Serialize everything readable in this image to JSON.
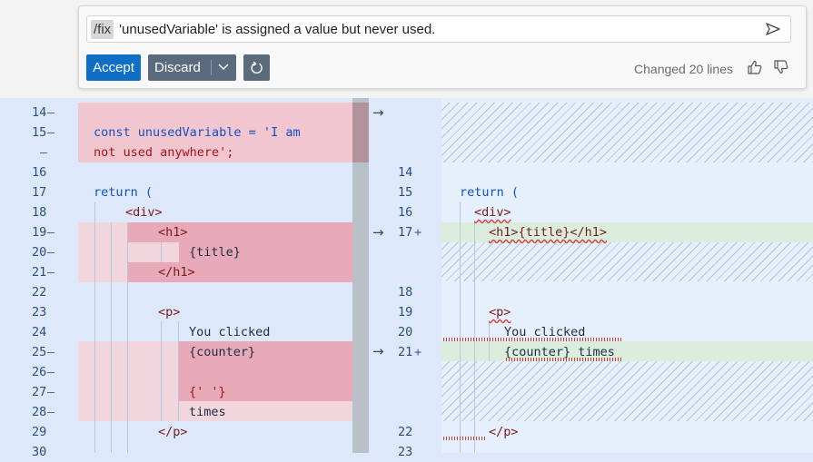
{
  "prompt": {
    "slash_command": "/fix",
    "text": "'unusedVariable' is assigned a value but never used."
  },
  "actions": {
    "accept_label": "Accept",
    "discard_label": "Discard"
  },
  "status": {
    "changed_text": "Changed 20 lines"
  },
  "icons": [
    "send-icon",
    "chevron-down-icon",
    "redo-icon",
    "thumbs-up-icon",
    "thumbs-down-icon",
    "arrow-right-icon"
  ],
  "colors": {
    "accept": "#0f6fc6",
    "discard": "#5b6b7e",
    "deleted_bg": "#f2c6cf",
    "added_bg": "#dbeede",
    "pane_bg": "#dde9fb"
  },
  "left": {
    "lines": [
      {
        "num": "14",
        "mark": "—",
        "code": ""
      },
      {
        "num": "15",
        "mark": "—",
        "code": "const unusedVariable = 'I am"
      },
      {
        "num": "",
        "mark": "—",
        "code": "not used anywhere';"
      },
      {
        "num": "16",
        "mark": "",
        "code": ""
      },
      {
        "num": "17",
        "mark": "",
        "code": "return ("
      },
      {
        "num": "18",
        "mark": "",
        "code": "<div>"
      },
      {
        "num": "19",
        "mark": "—",
        "code": "<h1>"
      },
      {
        "num": "20",
        "mark": "—",
        "code": "{title}"
      },
      {
        "num": "21",
        "mark": "—",
        "code": "</h1>"
      },
      {
        "num": "22",
        "mark": "",
        "code": ""
      },
      {
        "num": "23",
        "mark": "",
        "code": "<p>"
      },
      {
        "num": "24",
        "mark": "",
        "code": "You clicked"
      },
      {
        "num": "25",
        "mark": "—",
        "code": "{counter}"
      },
      {
        "num": "26",
        "mark": "—",
        "code": ""
      },
      {
        "num": "27",
        "mark": "—",
        "code": "{' '}"
      },
      {
        "num": "28",
        "mark": "—",
        "code": "times"
      },
      {
        "num": "29",
        "mark": "",
        "code": "</p>"
      },
      {
        "num": "30",
        "mark": "",
        "code": ""
      }
    ]
  },
  "right": {
    "lines": [
      {
        "num": "14",
        "mark": "",
        "code": ""
      },
      {
        "num": "15",
        "mark": "",
        "code": "return ("
      },
      {
        "num": "16",
        "mark": "",
        "code": "<div>"
      },
      {
        "num": "17",
        "mark": "+",
        "code": "<h1>{title}</h1>"
      },
      {
        "num": "18",
        "mark": "",
        "code": ""
      },
      {
        "num": "19",
        "mark": "",
        "code": "<p>"
      },
      {
        "num": "20",
        "mark": "",
        "code": "You clicked"
      },
      {
        "num": "21",
        "mark": "+",
        "code": "{counter} times"
      },
      {
        "num": "22",
        "mark": "",
        "code": "</p>"
      },
      {
        "num": "23",
        "mark": "",
        "code": ""
      }
    ]
  },
  "arrows": [
    "→",
    "→",
    "→"
  ]
}
